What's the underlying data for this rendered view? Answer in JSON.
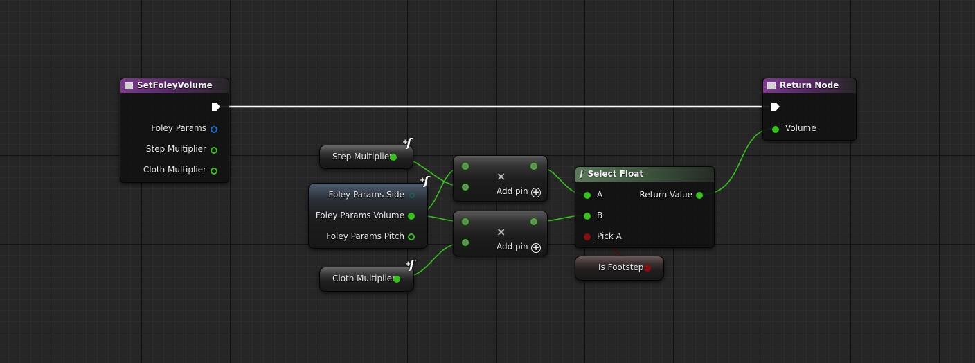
{
  "nodes": {
    "set_foley_volume": {
      "title": "SetFoleyVolume",
      "params": [
        "Foley Params",
        "Step Multiplier",
        "Cloth Multiplier"
      ]
    },
    "return_node": {
      "title": "Return Node",
      "params": [
        "Volume"
      ]
    },
    "step_multiplier_var": {
      "label": "Step Multiplier",
      "badge": "f"
    },
    "foley_params_break": {
      "badge": "f",
      "params": [
        "Foley Params Side",
        "Foley Params Volume",
        "Foley Params Pitch"
      ]
    },
    "cloth_multiplier_var": {
      "label": "Cloth Multiplier",
      "badge": "f"
    },
    "multiply_1": {
      "symbol": "×",
      "add_pin": "Add pin",
      "add_icon": "+"
    },
    "multiply_2": {
      "symbol": "×",
      "add_pin": "Add pin",
      "add_icon": "+"
    },
    "select_float": {
      "title": "Select Float",
      "badge": "f",
      "inputs": [
        "A",
        "B",
        "Pick A"
      ],
      "output": "Return Value"
    },
    "is_footstep_var": {
      "label": "Is Footstep"
    }
  },
  "colors": {
    "float_pin": "#35c21b",
    "struct_pin": "#1a6fd6",
    "bool_pin": "#8a0c0c",
    "exec_wire": "#ffffff",
    "function_header": "#7c3a8d",
    "pure_function_header": "#5a7a5a"
  }
}
